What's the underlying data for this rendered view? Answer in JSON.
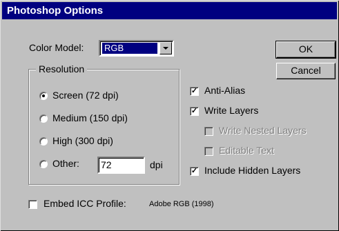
{
  "window": {
    "title": "Photoshop Options"
  },
  "color_model": {
    "label": "Color Model:",
    "value": "RGB"
  },
  "buttons": {
    "ok": "OK",
    "cancel": "Cancel"
  },
  "resolution": {
    "group_label": "Resolution",
    "options": [
      {
        "label": "Screen (72 dpi)",
        "selected": true
      },
      {
        "label": "Medium (150 dpi)",
        "selected": false
      },
      {
        "label": "High (300 dpi)",
        "selected": false
      },
      {
        "label": "Other:",
        "selected": false
      }
    ],
    "other_value": "72",
    "unit": "dpi"
  },
  "options": {
    "anti_alias": {
      "label": "Anti-Alias",
      "checked": true
    },
    "write_layers": {
      "label": "Write Layers",
      "checked": true
    },
    "write_nested_layers": {
      "label": "Write Nested Layers",
      "checked": false,
      "enabled": false
    },
    "editable_text": {
      "label": "Editable Text",
      "checked": false,
      "enabled": false
    },
    "include_hidden_layers": {
      "label": "Include Hidden Layers",
      "checked": true
    }
  },
  "icc": {
    "label": "Embed ICC Profile:",
    "checked": false,
    "profile": "Adobe RGB (1998)"
  },
  "check_glyph": "✓"
}
